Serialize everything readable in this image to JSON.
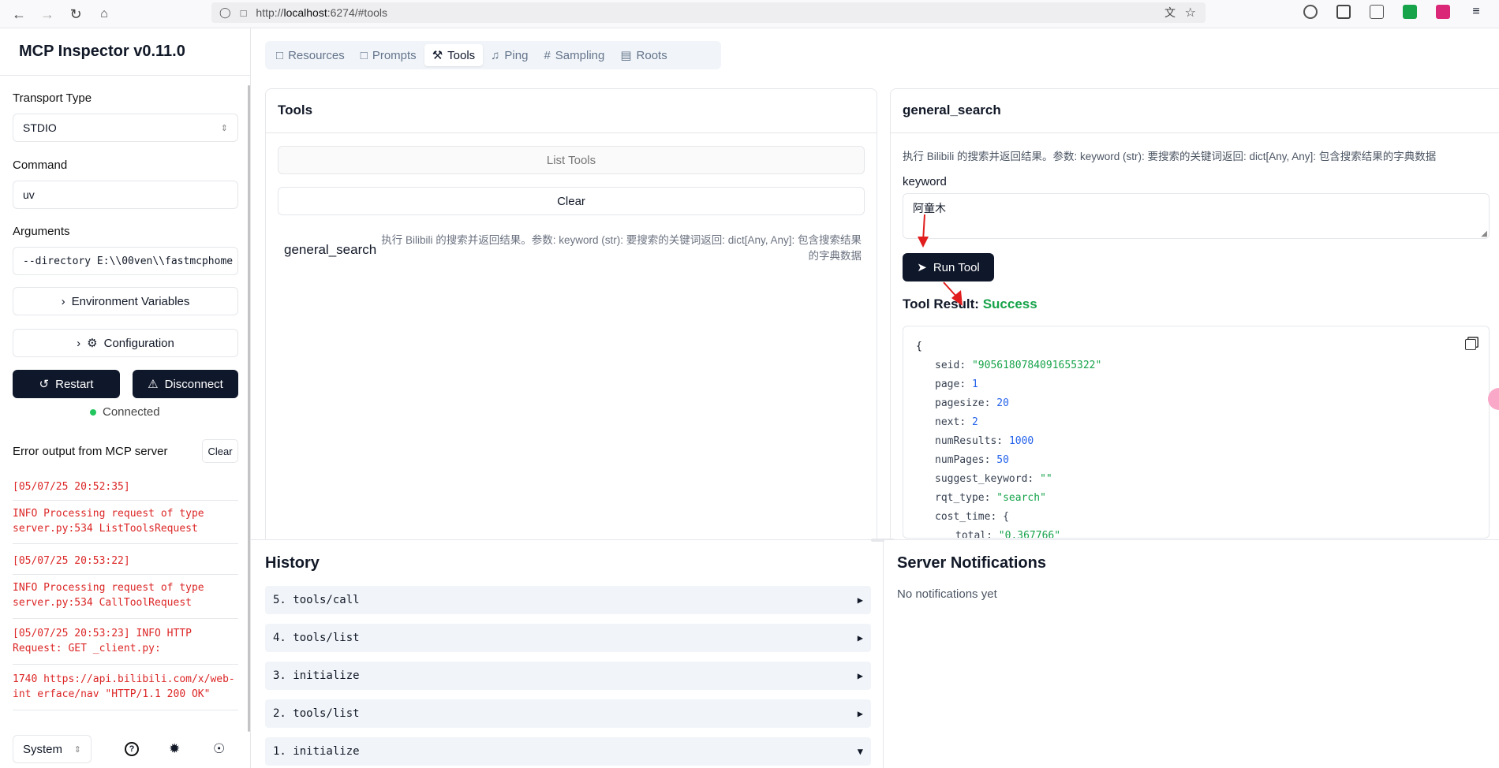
{
  "browser": {
    "url_prefix": "http://",
    "url_host": "localhost",
    "url_rest": ":6274/#tools"
  },
  "sidebar": {
    "title": "MCP Inspector v0.11.0",
    "transport_label": "Transport Type",
    "transport_value": "STDIO",
    "command_label": "Command",
    "command_value": "uv",
    "arguments_label": "Arguments",
    "arguments_value": "--directory E:\\\\00ven\\\\fastmcphome",
    "env_button": "Environment Variables",
    "config_button": "Configuration",
    "restart_button": "Restart",
    "disconnect_button": "Disconnect",
    "status": "Connected",
    "error_title": "Error output from MCP server",
    "clear_button": "Clear",
    "logs": [
      "[05/07/25 20:52:35]",
      "INFO Processing request of type server.py:534 ListToolsRequest",
      "[05/07/25 20:53:22]",
      "INFO Processing request of type server.py:534 CallToolRequest",
      "[05/07/25 20:53:23] INFO HTTP Request: GET _client.py:",
      "1740 https://api.bilibili.com/x/web-int  erface/nav \"HTTP/1.1 200 OK\""
    ],
    "theme_select": "System"
  },
  "tabs": [
    {
      "label": "Resources"
    },
    {
      "label": "Prompts"
    },
    {
      "label": "Tools"
    },
    {
      "label": "Ping"
    },
    {
      "label": "Sampling"
    },
    {
      "label": "Roots"
    }
  ],
  "tools_panel": {
    "title": "Tools",
    "list_button": "List Tools",
    "clear_button": "Clear",
    "tool_name": "general_search",
    "tool_desc": "执行 Bilibili 的搜索并返回结果。参数: keyword (str): 要搜索的关键词返回: dict[Any, Any]: 包含搜索结果的字典数据"
  },
  "detail_panel": {
    "title": "general_search",
    "description": "执行 Bilibili 的搜索并返回结果。参数: keyword (str): 要搜索的关键词返回: dict[Any, Any]: 包含搜索结果的字典数据",
    "param_label": "keyword",
    "param_value": "阿童木",
    "run_button": "Run Tool",
    "result_label": "Tool Result:",
    "result_status": "Success"
  },
  "json_result": [
    {
      "key": "seid",
      "value": "\"9056180784091655322\"",
      "kind": "string"
    },
    {
      "key": "page",
      "value": "1",
      "kind": "number"
    },
    {
      "key": "pagesize",
      "value": "20",
      "kind": "number"
    },
    {
      "key": "next",
      "value": "2",
      "kind": "number"
    },
    {
      "key": "numResults",
      "value": "1000",
      "kind": "number"
    },
    {
      "key": "numPages",
      "value": "50",
      "kind": "number"
    },
    {
      "key": "suggest_keyword",
      "value": "\"\"",
      "kind": "string"
    },
    {
      "key": "rqt_type",
      "value": "\"search\"",
      "kind": "string"
    },
    {
      "key": "cost_time",
      "value": "{",
      "kind": "brace"
    },
    {
      "key": "total",
      "value": "\"0.367766\"",
      "kind": "string"
    }
  ],
  "history": {
    "title": "History",
    "items": [
      "5. tools/call",
      "4. tools/list",
      "3. initialize",
      "2. tools/list",
      "1. initialize"
    ]
  },
  "notifications": {
    "title": "Server Notifications",
    "empty": "No notifications yet"
  },
  "colors": {
    "dark_button": "#0f172a",
    "success": "#16a34a",
    "error": "#dc2626",
    "annotation_arrow": "#e11d1d"
  }
}
